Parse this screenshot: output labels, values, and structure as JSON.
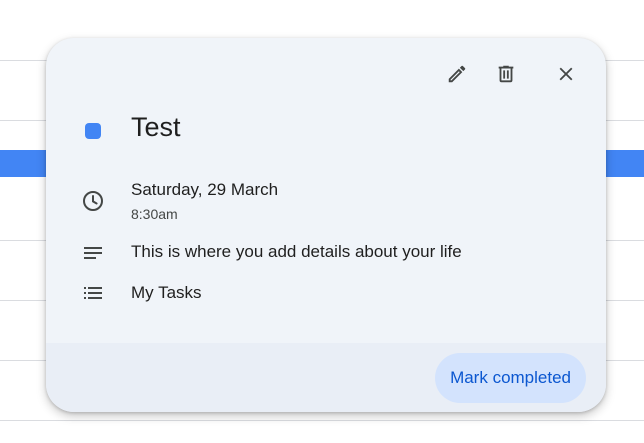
{
  "popup": {
    "toolbar": {
      "edit_icon": "pencil-icon",
      "delete_icon": "trash-icon",
      "close_icon": "close-icon"
    },
    "task": {
      "color": "#4285f4",
      "title": "Test",
      "date": "Saturday, 29 March",
      "time": "8:30am",
      "description": "This is where you add details about your life",
      "list_name": "My Tasks"
    },
    "footer": {
      "mark_completed_label": "Mark completed"
    }
  },
  "colors": {
    "popup_background": "#f0f4f9",
    "footer_background": "#e9eef6",
    "button_background": "#d3e3fd",
    "button_text": "#0b57d0",
    "background_event": "#4285f4"
  }
}
